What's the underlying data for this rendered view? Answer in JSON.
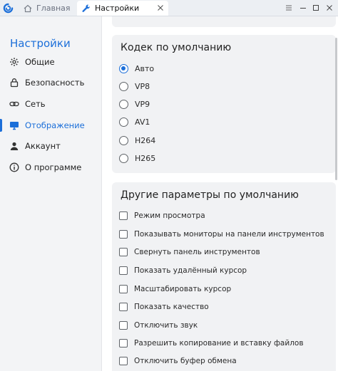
{
  "titlebar": {
    "tabs": [
      {
        "label": "Главная",
        "icon": "home-icon"
      },
      {
        "label": "Настройки",
        "icon": "wrench-icon"
      }
    ],
    "controls": [
      "menu-icon",
      "minimize-icon",
      "maximize-icon",
      "close-icon"
    ]
  },
  "sidebar": {
    "title": "Настройки",
    "items": [
      {
        "label": "Общие",
        "icon": "gear-icon"
      },
      {
        "label": "Безопасность",
        "icon": "lock-icon"
      },
      {
        "label": "Сеть",
        "icon": "link-icon"
      },
      {
        "label": "Отображение",
        "icon": "monitor-icon",
        "active": true
      },
      {
        "label": "Аккаунт",
        "icon": "user-icon"
      },
      {
        "label": "О программе",
        "icon": "info-icon"
      }
    ]
  },
  "codec": {
    "title": "Кодек по умолчанию",
    "options": [
      "Авто",
      "VP8",
      "VP9",
      "AV1",
      "H264",
      "H265"
    ],
    "selected": "Авто"
  },
  "other": {
    "title": "Другие параметры по умолчанию",
    "options": [
      "Режим просмотра",
      "Показывать мониторы на панели инструментов",
      "Свернуть панель инструментов",
      "Показать удалённый курсор",
      "Масштабировать курсор",
      "Показать качество",
      "Отключить звук",
      "Разрешить копирование и вставку файлов",
      "Отключить буфер обмена"
    ]
  },
  "colors": {
    "accent": "#1c6fd9",
    "card": "#f1f2f4",
    "sidebar": "#f3f4f6"
  }
}
